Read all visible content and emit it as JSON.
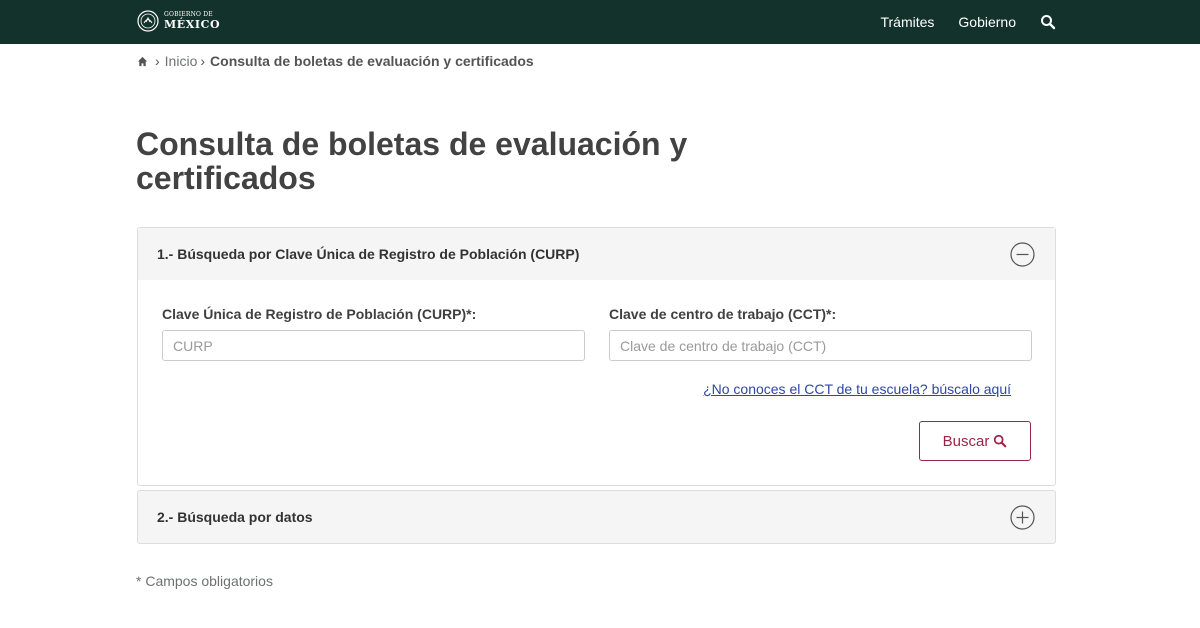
{
  "header": {
    "logo_line1": "GOBIERNO DE",
    "logo_line2": "MÉXICO",
    "nav": [
      {
        "label": "Trámites"
      },
      {
        "label": "Gobierno"
      }
    ],
    "search_icon": "search-icon"
  },
  "breadcrumb": {
    "home_icon": "home-icon",
    "separator": "›",
    "items": [
      {
        "label": "Inicio"
      },
      {
        "label": "Consulta de boletas de evaluación y certificados"
      }
    ]
  },
  "page": {
    "title": "Consulta de boletas de evaluación y certificados"
  },
  "panels": [
    {
      "title": "1.- Búsqueda por Clave Única de Registro de Población (CURP)",
      "toggle_icon": "minus-circle-icon",
      "expanded": true,
      "fields": [
        {
          "label": "Clave Única de Registro de Población (CURP)*:",
          "placeholder": "CURP",
          "value": ""
        },
        {
          "label": "Clave de centro de trabajo (CCT)*:",
          "placeholder": "Clave de centro de trabajo (CCT)",
          "value": ""
        }
      ],
      "help_link": "¿No conoces el CCT de tu escuela? búscalo aquí",
      "button_label": "Buscar",
      "button_icon": "search-icon"
    },
    {
      "title": "2.- Búsqueda por datos",
      "toggle_icon": "plus-circle-icon",
      "expanded": false
    }
  ],
  "footnote": "* Campos obligatorios",
  "colors": {
    "header_bg": "#13322b",
    "accent": "#9d2449",
    "link": "#2f46a3",
    "panel_header_bg": "#f5f5f5"
  }
}
